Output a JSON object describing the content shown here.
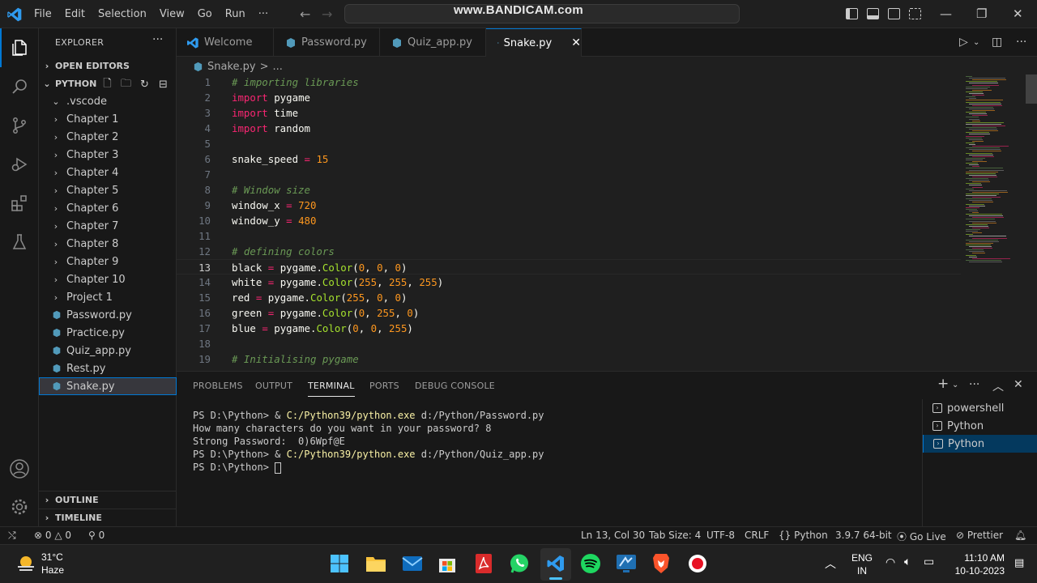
{
  "titlebar": {
    "menu": [
      "File",
      "Edit",
      "Selection",
      "View",
      "Go",
      "Run",
      "···"
    ],
    "watermark": "www.BANDICAM.com",
    "brand_color": "#0078d4"
  },
  "sidebar": {
    "header": "EXPLORER",
    "more": "···",
    "open_editors": "OPEN EDITORS",
    "root": "PYTHON",
    "items": [
      {
        "label": ".vscode",
        "kind": "folder-open"
      },
      {
        "label": "Chapter 1",
        "kind": "folder"
      },
      {
        "label": "Chapter 2",
        "kind": "folder"
      },
      {
        "label": "Chapter 3",
        "kind": "folder"
      },
      {
        "label": "Chapter 4",
        "kind": "folder"
      },
      {
        "label": "Chapter 5",
        "kind": "folder"
      },
      {
        "label": "Chapter 6",
        "kind": "folder"
      },
      {
        "label": "Chapter 7",
        "kind": "folder"
      },
      {
        "label": "Chapter 8",
        "kind": "folder"
      },
      {
        "label": "Chapter 9",
        "kind": "folder"
      },
      {
        "label": "Chapter 10",
        "kind": "folder"
      },
      {
        "label": "Project 1",
        "kind": "folder"
      },
      {
        "label": "Password.py",
        "kind": "file"
      },
      {
        "label": "Practice.py",
        "kind": "file"
      },
      {
        "label": "Quiz_app.py",
        "kind": "file"
      },
      {
        "label": "Rest.py",
        "kind": "file"
      },
      {
        "label": "Snake.py",
        "kind": "file",
        "selected": true
      }
    ],
    "outline": "OUTLINE",
    "timeline": "TIMELINE"
  },
  "tabs": [
    {
      "label": "Welcome",
      "icon": "vscode-icon"
    },
    {
      "label": "Password.py",
      "icon": "python-file-icon"
    },
    {
      "label": "Quiz_app.py",
      "icon": "python-file-icon"
    },
    {
      "label": "Snake.py",
      "icon": "python-file-icon",
      "active": true
    }
  ],
  "breadcrumb": {
    "file": "Snake.py",
    "sep": ">",
    "rest": "..."
  },
  "editor": {
    "current_line": 13,
    "lines": [
      {
        "n": "1",
        "tokens": [
          {
            "t": "# importing libraries",
            "c": "comment"
          }
        ]
      },
      {
        "n": "2",
        "tokens": [
          {
            "t": "import",
            "c": "kw"
          },
          {
            "t": " pygame",
            "c": "id"
          }
        ]
      },
      {
        "n": "3",
        "tokens": [
          {
            "t": "import",
            "c": "kw"
          },
          {
            "t": " time",
            "c": "id"
          }
        ]
      },
      {
        "n": "4",
        "tokens": [
          {
            "t": "import",
            "c": "kw"
          },
          {
            "t": " random",
            "c": "id"
          }
        ]
      },
      {
        "n": "5",
        "tokens": []
      },
      {
        "n": "6",
        "tokens": [
          {
            "t": "snake_speed ",
            "c": "id"
          },
          {
            "t": "=",
            "c": "op"
          },
          {
            "t": " 15",
            "c": "num"
          }
        ]
      },
      {
        "n": "7",
        "tokens": []
      },
      {
        "n": "8",
        "tokens": [
          {
            "t": "# Window size",
            "c": "comment"
          }
        ]
      },
      {
        "n": "9",
        "tokens": [
          {
            "t": "window_x ",
            "c": "id"
          },
          {
            "t": "=",
            "c": "op"
          },
          {
            "t": " 720",
            "c": "num"
          }
        ]
      },
      {
        "n": "10",
        "tokens": [
          {
            "t": "window_y ",
            "c": "id"
          },
          {
            "t": "=",
            "c": "op"
          },
          {
            "t": " 480",
            "c": "num"
          }
        ]
      },
      {
        "n": "11",
        "tokens": []
      },
      {
        "n": "12",
        "tokens": [
          {
            "t": "# defining colors",
            "c": "comment"
          }
        ]
      },
      {
        "n": "13",
        "tokens": [
          {
            "t": "black ",
            "c": "id"
          },
          {
            "t": "=",
            "c": "op"
          },
          {
            "t": " pygame.",
            "c": "id"
          },
          {
            "t": "Color",
            "c": "fn"
          },
          {
            "t": "(",
            "c": "punct"
          },
          {
            "t": "0",
            "c": "num"
          },
          {
            "t": ", ",
            "c": "punct"
          },
          {
            "t": "0",
            "c": "num"
          },
          {
            "t": ", ",
            "c": "punct"
          },
          {
            "t": "0",
            "c": "num"
          },
          {
            "t": ")",
            "c": "punct"
          }
        ]
      },
      {
        "n": "14",
        "tokens": [
          {
            "t": "white ",
            "c": "id"
          },
          {
            "t": "=",
            "c": "op"
          },
          {
            "t": " pygame.",
            "c": "id"
          },
          {
            "t": "Color",
            "c": "fn"
          },
          {
            "t": "(",
            "c": "punct"
          },
          {
            "t": "255",
            "c": "num"
          },
          {
            "t": ", ",
            "c": "punct"
          },
          {
            "t": "255",
            "c": "num"
          },
          {
            "t": ", ",
            "c": "punct"
          },
          {
            "t": "255",
            "c": "num"
          },
          {
            "t": ")",
            "c": "punct"
          }
        ]
      },
      {
        "n": "15",
        "tokens": [
          {
            "t": "red ",
            "c": "id"
          },
          {
            "t": "=",
            "c": "op"
          },
          {
            "t": " pygame.",
            "c": "id"
          },
          {
            "t": "Color",
            "c": "fn"
          },
          {
            "t": "(",
            "c": "punct"
          },
          {
            "t": "255",
            "c": "num"
          },
          {
            "t": ", ",
            "c": "punct"
          },
          {
            "t": "0",
            "c": "num"
          },
          {
            "t": ", ",
            "c": "punct"
          },
          {
            "t": "0",
            "c": "num"
          },
          {
            "t": ")",
            "c": "punct"
          }
        ]
      },
      {
        "n": "16",
        "tokens": [
          {
            "t": "green ",
            "c": "id"
          },
          {
            "t": "=",
            "c": "op"
          },
          {
            "t": " pygame.",
            "c": "id"
          },
          {
            "t": "Color",
            "c": "fn"
          },
          {
            "t": "(",
            "c": "punct"
          },
          {
            "t": "0",
            "c": "num"
          },
          {
            "t": ", ",
            "c": "punct"
          },
          {
            "t": "255",
            "c": "num"
          },
          {
            "t": ", ",
            "c": "punct"
          },
          {
            "t": "0",
            "c": "num"
          },
          {
            "t": ")",
            "c": "punct"
          }
        ]
      },
      {
        "n": "17",
        "tokens": [
          {
            "t": "blue ",
            "c": "id"
          },
          {
            "t": "=",
            "c": "op"
          },
          {
            "t": " pygame.",
            "c": "id"
          },
          {
            "t": "Color",
            "c": "fn"
          },
          {
            "t": "(",
            "c": "punct"
          },
          {
            "t": "0",
            "c": "num"
          },
          {
            "t": ", ",
            "c": "punct"
          },
          {
            "t": "0",
            "c": "num"
          },
          {
            "t": ", ",
            "c": "punct"
          },
          {
            "t": "255",
            "c": "num"
          },
          {
            "t": ")",
            "c": "punct"
          }
        ]
      },
      {
        "n": "18",
        "tokens": []
      },
      {
        "n": "19",
        "tokens": [
          {
            "t": "# Initialising pygame",
            "c": "comment"
          }
        ]
      }
    ]
  },
  "panel": {
    "tabs": [
      "PROBLEMS",
      "OUTPUT",
      "TERMINAL",
      "PORTS",
      "DEBUG CONSOLE"
    ],
    "active_tab": "TERMINAL",
    "terminal_lines": [
      {
        "prompt": "PS D:\\Python> & ",
        "cmd": "C:/Python39/python.exe",
        "rest": " d:/Python/Password.py"
      },
      {
        "prompt": "How many characters do you want in your password? 8",
        "cmd": "",
        "rest": ""
      },
      {
        "prompt": "Strong Password:  0)6Wpf@E",
        "cmd": "",
        "rest": ""
      },
      {
        "prompt": "PS D:\\Python> & ",
        "cmd": "C:/Python39/python.exe",
        "rest": " d:/Python/Quiz_app.py"
      },
      {
        "prompt": "PS D:\\Python> ",
        "cmd": "",
        "rest": "",
        "cursor": true
      }
    ],
    "terminals": [
      {
        "label": "powershell",
        "active": false
      },
      {
        "label": "Python",
        "active": false
      },
      {
        "label": "Python",
        "active": true
      }
    ]
  },
  "statusbar": {
    "remote": "⨯",
    "errors": "0",
    "warnings": "0",
    "ports": "0",
    "position": "Ln 13, Col 30",
    "tab_size": "Tab Size: 4",
    "encoding": "UTF-8",
    "eol": "CRLF",
    "language": "Python",
    "interpreter": "3.9.7 64-bit",
    "go_live": "Go Live",
    "prettier": "Prettier"
  },
  "taskbar": {
    "weather_temp": "31°C",
    "weather_desc": "Haze",
    "lang_top": "ENG",
    "lang_bottom": "IN",
    "time": "11:10 AM",
    "date": "10-10-2023"
  }
}
